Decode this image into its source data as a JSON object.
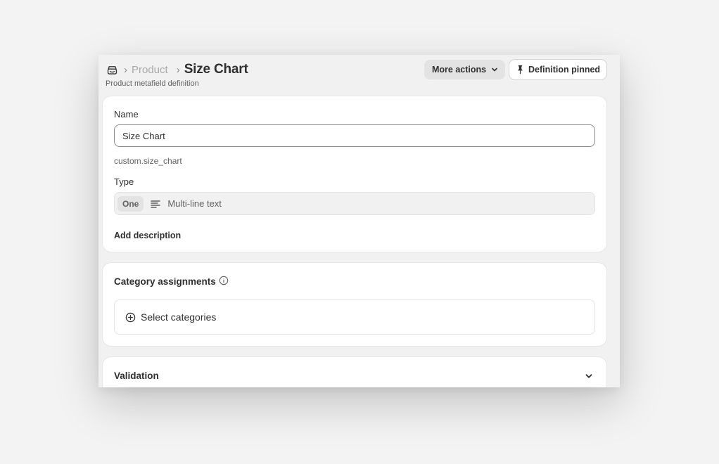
{
  "header": {
    "breadcrumb_parent": "Product",
    "breadcrumb_separator": "›",
    "title": "Size Chart",
    "subtitle": "Product metafield definition",
    "home_icon": "store-icon",
    "more_actions_label": "More actions",
    "pin_label": "Definition pinned"
  },
  "name_card": {
    "name_label": "Name",
    "name_value": "Size Chart",
    "namespace_key": "custom.size_chart",
    "type_label": "Type",
    "type_badge": "One",
    "type_icon": "text-lines-icon",
    "type_value": "Multi-line text",
    "add_description_label": "Add description"
  },
  "category_card": {
    "title": "Category assignments",
    "info_icon": "info-icon",
    "select_label": "Select categories",
    "select_icon": "plus-circle-icon"
  },
  "validation_card": {
    "title": "Validation",
    "expand_icon": "chevron-down-icon"
  },
  "colors": {
    "page_bg": "#f3f3f3",
    "surface": "#ffffff",
    "text": "#303030",
    "muted_text": "#616161",
    "secondary_button_bg": "#e3e3e3"
  }
}
